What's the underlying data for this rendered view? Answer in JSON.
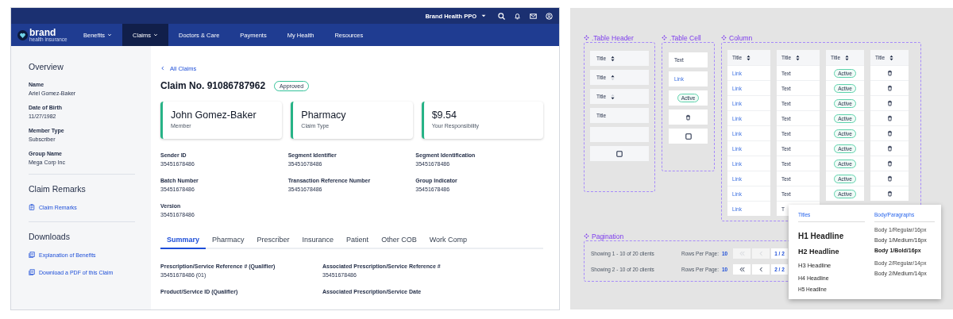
{
  "claims_app": {
    "top_bar": {
      "plan_menu": "Brand Health PPO"
    },
    "logo": {
      "name": "brand",
      "tagline": "health insurance"
    },
    "nav": [
      {
        "label": "Benefits",
        "dropdown": true,
        "selected": false
      },
      {
        "label": "Claims",
        "dropdown": true,
        "selected": true
      },
      {
        "label": "Doctors & Care",
        "dropdown": false,
        "selected": false
      },
      {
        "label": "Payments",
        "dropdown": false,
        "selected": false
      },
      {
        "label": "My Health",
        "dropdown": false,
        "selected": false
      },
      {
        "label": "Resources",
        "dropdown": false,
        "selected": false
      }
    ],
    "sidebar": {
      "sections": [
        {
          "title": "Overview",
          "fields": [
            {
              "label": "Name",
              "value": "Ariel Gomez-Baker"
            },
            {
              "label": "Date of Birth",
              "value": "11/27/1982"
            },
            {
              "label": "Member Type",
              "value": "Subscriber"
            },
            {
              "label": "Group Name",
              "value": "Mega Corp Inc"
            }
          ]
        },
        {
          "title": "Claim Remarks",
          "links": [
            {
              "kind": "note",
              "text": "Claim Remarks"
            }
          ]
        },
        {
          "title": "Downloads",
          "links": [
            {
              "kind": "file",
              "text": "Explanation of Benefits"
            },
            {
              "kind": "file",
              "text": "Download a PDF of this Claim"
            }
          ]
        }
      ]
    },
    "main": {
      "back_link": "All Claims",
      "title": "Claim No. 91086787962",
      "status": "Approved",
      "summary_cards": [
        {
          "value": "John Gomez-Baker",
          "label": "Member"
        },
        {
          "value": "Pharmacy",
          "label": "Claim Type"
        },
        {
          "value": "$9.54",
          "label": "Your Responsibility"
        }
      ],
      "fields": [
        {
          "label": "Sender ID",
          "value": "35451678486"
        },
        {
          "label": "Segment Identifier",
          "value": "35451678486"
        },
        {
          "label": "Segment Identification",
          "value": "35451678486"
        },
        {
          "label": "Batch Number",
          "value": "35451678486"
        },
        {
          "label": "Transaction Reference Number",
          "value": "35451678486"
        },
        {
          "label": "Group Indicator",
          "value": "35451678486"
        },
        {
          "label": "Version",
          "value": "35451678486"
        }
      ],
      "tabs": [
        {
          "label": "Summary",
          "selected": true
        },
        {
          "label": "Pharmacy",
          "selected": false
        },
        {
          "label": "Prescriber",
          "selected": false
        },
        {
          "label": "Insurance",
          "selected": false
        },
        {
          "label": "Patient",
          "selected": false
        },
        {
          "label": "Other COB",
          "selected": false
        },
        {
          "label": "Work Comp",
          "selected": false
        }
      ],
      "details": [
        {
          "label": "Prescription/Service Reference #  (Qualifier)",
          "value": "35451678486 (01)"
        },
        {
          "label": "Associated Prescription/Service Reference #",
          "value": "35451678486"
        },
        {
          "label": "Product/Service ID  (Qualifier)"
        },
        {
          "label": "Associated Prescription/Service Date"
        }
      ]
    }
  },
  "design_kit": {
    "table_header": {
      "title": ".Table Header",
      "items": [
        {
          "kind": "sortable",
          "label": "Title"
        },
        {
          "kind": "ascending",
          "label": "Title"
        },
        {
          "kind": "descending",
          "label": "Title"
        },
        {
          "kind": "plain",
          "label": "Title"
        },
        {
          "kind": "empty"
        },
        {
          "kind": "checkbox",
          "checked": false
        }
      ]
    },
    "table_cell": {
      "title": ".Table Cell",
      "items": [
        {
          "kind": "text",
          "text": "Text"
        },
        {
          "kind": "link",
          "text": "Link"
        },
        {
          "kind": "status",
          "text": "Active"
        },
        {
          "kind": "delete"
        },
        {
          "kind": "checkbox",
          "checked": false
        }
      ]
    },
    "column": {
      "title": "Column",
      "columns": [
        {
          "header": "Title",
          "cells": [
            {
              "kind": "link",
              "text": "Link"
            },
            {
              "kind": "link",
              "text": "Link"
            },
            {
              "kind": "link",
              "text": "Link"
            },
            {
              "kind": "link",
              "text": "Link"
            },
            {
              "kind": "link",
              "text": "Link"
            },
            {
              "kind": "link",
              "text": "Link"
            },
            {
              "kind": "link",
              "text": "Link"
            },
            {
              "kind": "link",
              "text": "Link"
            },
            {
              "kind": "link",
              "text": "Link"
            },
            {
              "kind": "link",
              "text": "Link"
            }
          ]
        },
        {
          "header": "Title",
          "cells": [
            {
              "kind": "text",
              "text": "Text"
            },
            {
              "kind": "text",
              "text": "Text"
            },
            {
              "kind": "text",
              "text": "Text"
            },
            {
              "kind": "text",
              "text": "Text"
            },
            {
              "kind": "text",
              "text": "Text"
            },
            {
              "kind": "text",
              "text": "Text"
            },
            {
              "kind": "text",
              "text": "Text"
            },
            {
              "kind": "text",
              "text": "Text"
            },
            {
              "kind": "text",
              "text": "Text"
            },
            {
              "kind": "text",
              "text": "T"
            }
          ]
        },
        {
          "header": "Title",
          "cells": [
            {
              "kind": "status",
              "text": "Active"
            },
            {
              "kind": "status",
              "text": "Active"
            },
            {
              "kind": "status",
              "text": "Active"
            },
            {
              "kind": "status",
              "text": "Active"
            },
            {
              "kind": "status",
              "text": "Active"
            },
            {
              "kind": "status",
              "text": "Active"
            },
            {
              "kind": "status",
              "text": "Active"
            },
            {
              "kind": "status",
              "text": "Active"
            },
            {
              "kind": "status",
              "text": "Active"
            }
          ]
        },
        {
          "header": "Title",
          "cells": [
            {
              "kind": "delete"
            },
            {
              "kind": "delete"
            },
            {
              "kind": "delete"
            },
            {
              "kind": "delete"
            },
            {
              "kind": "delete"
            },
            {
              "kind": "delete"
            },
            {
              "kind": "delete"
            },
            {
              "kind": "delete"
            },
            {
              "kind": "delete"
            }
          ]
        }
      ]
    },
    "pagination": {
      "title": "Pagination",
      "rows": [
        {
          "summary": "Showing 1 - 10 of 20 clients",
          "rows_label": "Rows Per Page:",
          "rows_value": "10",
          "first_disabled": true,
          "prev_disabled": true,
          "page": "1 / 2"
        },
        {
          "summary": "Showing 2 - 10 of 20 clients",
          "rows_label": "Rows Per Page:",
          "rows_value": "10",
          "first_disabled": false,
          "prev_disabled": false,
          "page": "2 / 2"
        }
      ]
    },
    "typography": {
      "titles_heading": "Titles",
      "titles": [
        "H1 Headline",
        "H2 Headline",
        "H3 Headline",
        "H4 Headline",
        "H5 Headline"
      ],
      "body_heading": "Body/Paragraphs",
      "body_groups": [
        [
          "Body 1/Regular/16px",
          "Body 1/Medium/16px",
          "Body 1/Bold/16px"
        ],
        [
          "Body 2/Regular/14px",
          "Body 2/Medium/14px"
        ]
      ]
    }
  }
}
